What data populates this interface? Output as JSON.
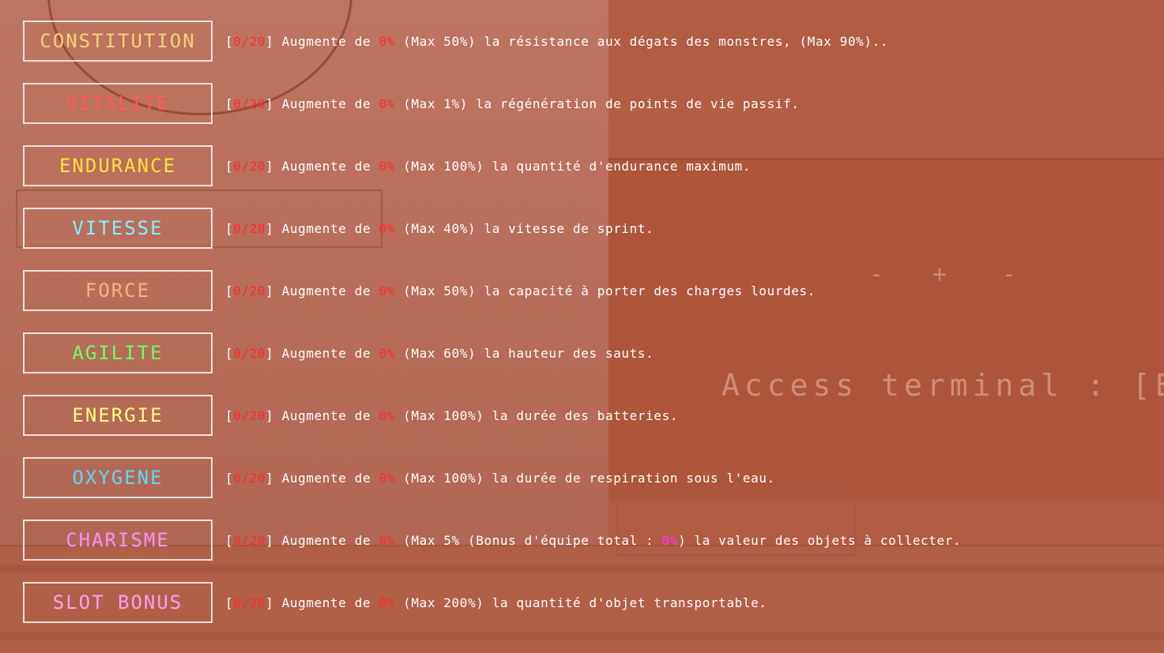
{
  "colors": {
    "highlight_red": "#ff2a2a",
    "bonus_magenta": "#ff33ff",
    "border": "#f2e4de"
  },
  "background": {
    "terminal_hint": "Access terminal : [E]",
    "controls": [
      "-",
      "+",
      "-"
    ]
  },
  "stats": [
    {
      "label": "CONSTITUTION",
      "color": "#f2d278",
      "open": "[",
      "level": "0/20",
      "close": "]",
      "pre": " Augmente de ",
      "pct": "0%",
      "post": " (Max 50%) la résistance aux dégats des monstres, (Max 90%).."
    },
    {
      "label": "VITALITE",
      "color": "#ff5a5a",
      "open": "[",
      "level": "0/20",
      "close": "]",
      "pre": " Augmente de ",
      "pct": "0%",
      "post": " (Max 1%) la régénération de points de vie passif."
    },
    {
      "label": "ENDURANCE",
      "color": "#ffe23a",
      "open": "[",
      "level": "0/20",
      "close": "]",
      "pre": " Augmente de ",
      "pct": "0%",
      "post": " (Max 100%) la quantité d'endurance maximum."
    },
    {
      "label": "VITESSE",
      "color": "#7ff0ff",
      "open": "[",
      "level": "0/20",
      "close": "]",
      "pre": " Augmente de ",
      "pct": "0%",
      "post": " (Max 40%) la vitesse de sprint."
    },
    {
      "label": "FORCE",
      "color": "#ffb07a",
      "open": "[",
      "level": "0/20",
      "close": "]",
      "pre": " Augmente de ",
      "pct": "0%",
      "post": " (Max 50%) la capacité à porter des charges lourdes."
    },
    {
      "label": "AGILITE",
      "color": "#6cff6c",
      "open": "[",
      "level": "0/20",
      "close": "]",
      "pre": " Augmente de ",
      "pct": "0%",
      "post": " (Max 60%) la hauteur des sauts."
    },
    {
      "label": "ENERGIE",
      "color": "#ffff80",
      "open": "[",
      "level": "0/20",
      "close": "]",
      "pre": " Augmente de ",
      "pct": "0%",
      "post": " (Max 100%) la durée des batteries."
    },
    {
      "label": "OXYGENE",
      "color": "#5ad8ff",
      "open": "[",
      "level": "0/20",
      "close": "]",
      "pre": " Augmente de ",
      "pct": "0%",
      "post": " (Max 100%) la durée de respiration sous l'eau."
    },
    {
      "label": "CHARISME",
      "color": "#ff8cf0",
      "open": "[",
      "level": "0/20",
      "close": "]",
      "pre": " Augmente de ",
      "pct": "0%",
      "post": " (Max 5% (Bonus d'équipe total : ",
      "bonus": "0%",
      "post2": ") la valeur des objets à collecter."
    },
    {
      "label": "SLOT BONUS",
      "color": "#ff9cf2",
      "open": "[",
      "level": "0/20",
      "close": "]",
      "pre": " Augmente de ",
      "pct": "0%",
      "post": " (Max 200%) la quantité d'objet transportable."
    }
  ]
}
